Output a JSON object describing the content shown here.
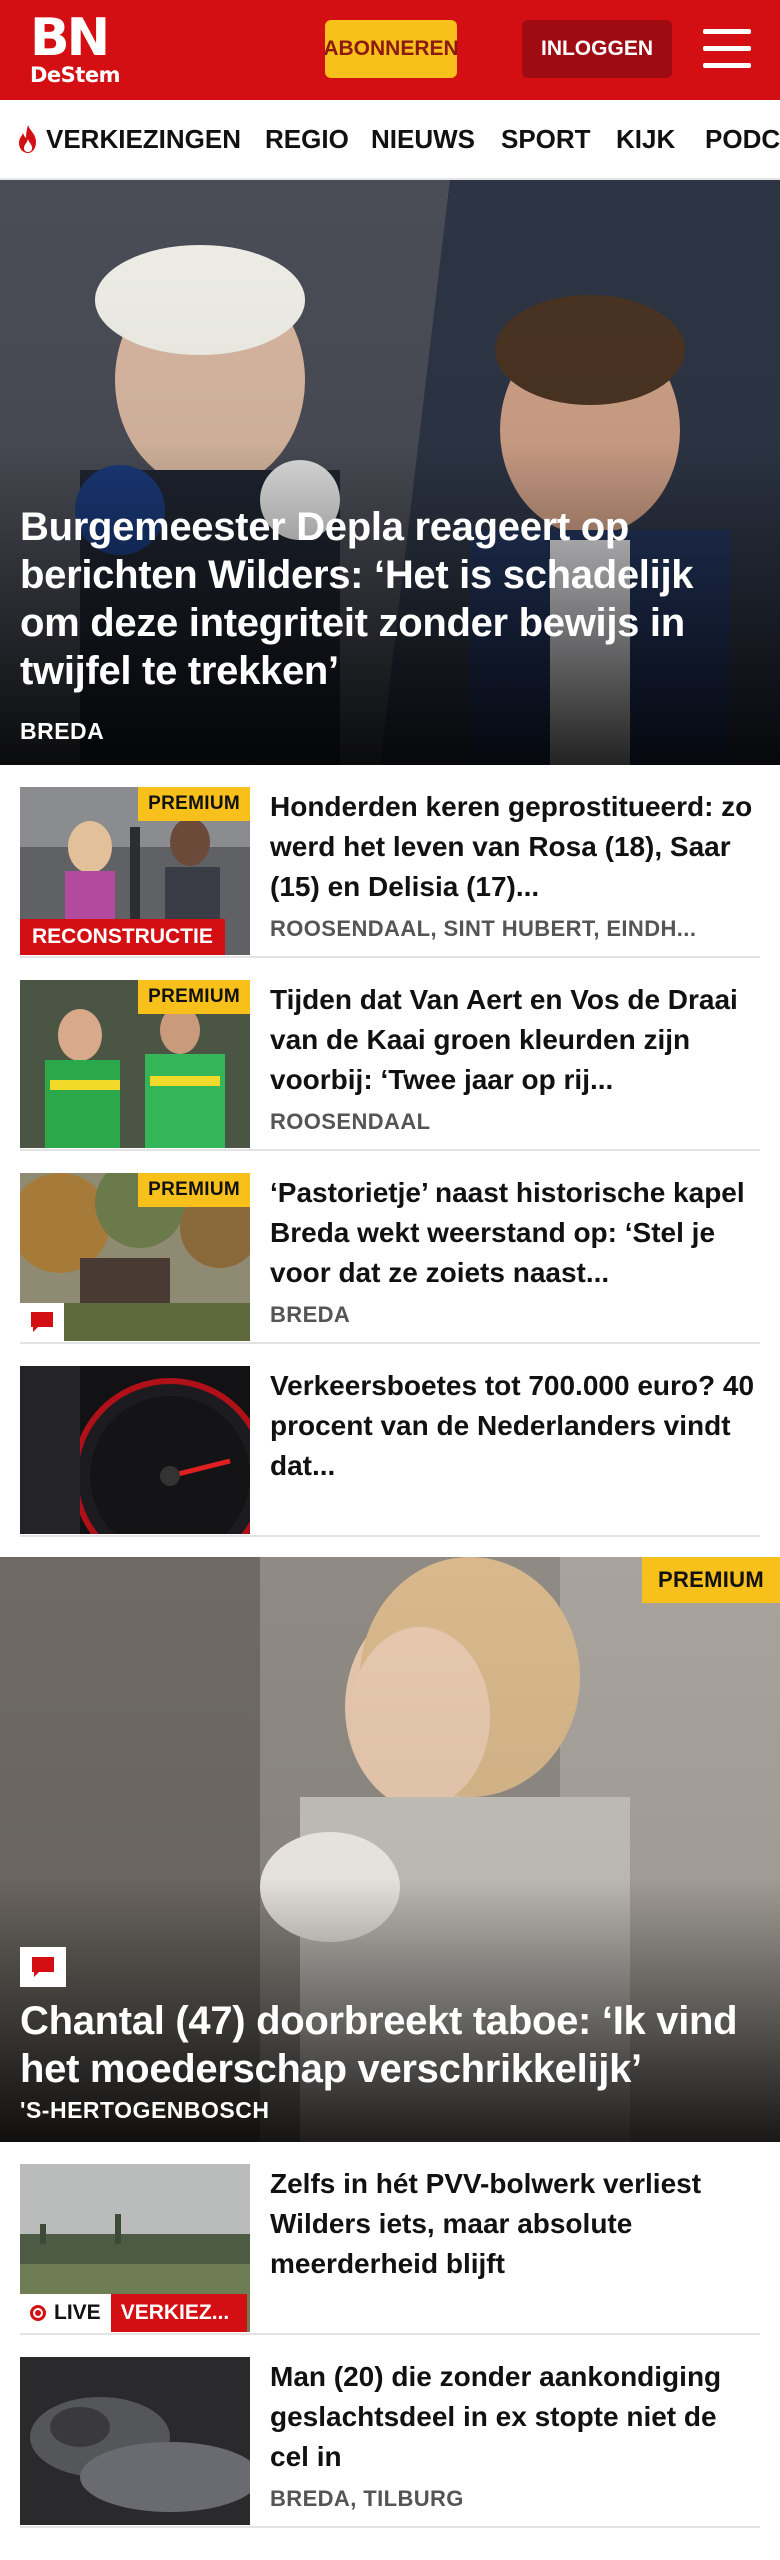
{
  "header": {
    "logo_main": "BN",
    "logo_sub": "DeStem",
    "subscribe_label": "ABONNEREN",
    "login_label": "INLOGGEN",
    "menu_icon": "hamburger-menu-icon",
    "brand_color": "#d40f14"
  },
  "nav": {
    "items": [
      {
        "label": "VERKIEZINGEN",
        "icon": "flame-icon"
      },
      {
        "label": "REGIO"
      },
      {
        "label": "NIEUWS"
      },
      {
        "label": "SPORT"
      },
      {
        "label": "KIJK"
      },
      {
        "label": "PODC"
      }
    ]
  },
  "hero": {
    "title": "Burgemeester Depla reageert op berichten Wilders: ‘Het is schadelijk om deze integriteit zonder bewijs in twijfel te trekken’",
    "location": "BREDA"
  },
  "articles": [
    {
      "title": "Honderden keren geprostitueerd: zo werd het leven van Rosa (18), Saar (15) en Delisia (17)...",
      "location": "ROOSENDAAL, SINT HUBERT, EINDH...",
      "premium": "PREMIUM",
      "tag": "RECONSTRUCTIE"
    },
    {
      "title": "Tijden dat Van Aert en Vos de Draai van de Kaai groen kleurden zijn voorbij: ‘Twee jaar op rij...",
      "location": "ROOSENDAAL",
      "premium": "PREMIUM"
    },
    {
      "title": "‘Pastorietje’ naast historische kapel Breda wekt weerstand op: ‘Stel je voor dat ze zoiets naast...",
      "location": "BREDA",
      "premium": "PREMIUM",
      "comment_icon": "comment-icon"
    },
    {
      "title": "Verkeersboetes tot 700.000 euro? 40 procent van de Nederlanders vindt dat...",
      "location": ""
    }
  ],
  "hero2": {
    "premium": "PREMIUM",
    "title": "Chantal (47) doorbreekt taboe: ‘Ik vind het moederschap verschrikkelijk’",
    "location": "'S-HERTOGENBOSCH",
    "comment_icon": "comment-icon"
  },
  "articles2": [
    {
      "title": "Zelfs in hét PVV-bolwerk verliest Wilders iets, maar absolute meerderheid blijft",
      "live_label": "LIVE",
      "category": "VERKIEZ..."
    },
    {
      "title": "Man (20) die zonder aankondiging geslachtsdeel in ex stopte niet de cel in",
      "location": "BREDA, TILBURG"
    }
  ]
}
